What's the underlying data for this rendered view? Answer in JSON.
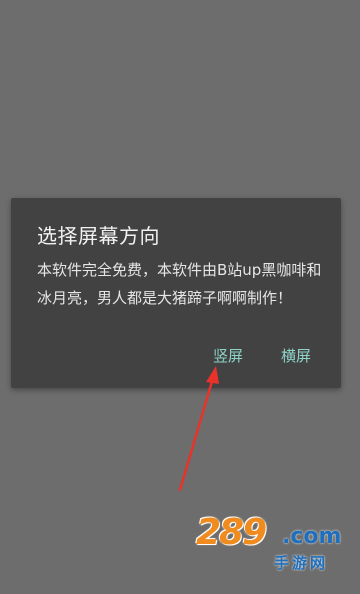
{
  "dialog": {
    "title": "选择屏幕方向",
    "message": "本软件完全免费，本软件由B站up黑咖啡和冰月亮，男人都是大猪蹄子啊啊制作！",
    "buttons": {
      "portrait": "竖屏",
      "landscape": "横屏"
    }
  },
  "watermark": {
    "number": "289",
    "domain": ".com",
    "subtitle": "手游网"
  },
  "colors": {
    "overlay": "#6d6d6d",
    "dialog_bg": "#424242",
    "accent": "#8ed3c8",
    "arrow": "#e8322a",
    "watermark_orange": "#f08b1f",
    "watermark_blue": "#1f6fbd"
  },
  "annotations": {
    "arrow_icon": "red-arrow-icon"
  }
}
